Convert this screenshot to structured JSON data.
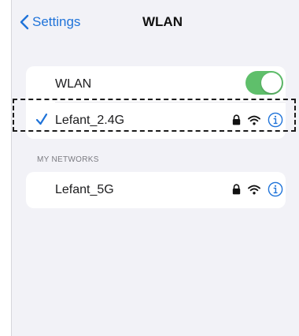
{
  "navbar": {
    "back_label": "Settings",
    "title": "WLAN"
  },
  "wlan_group": {
    "toggle_label": "WLAN",
    "toggle_on": true,
    "connected_network": "Lefant_2.4G"
  },
  "section_header": "MY NETWORKS",
  "my_networks": [
    {
      "name": "Lefant_5G"
    }
  ],
  "colors": {
    "accent": "#1f73d9",
    "toggle_on": "#5fbf6b",
    "background": "#f2f2f7"
  },
  "icons": [
    "chevron-left-icon",
    "checkmark-icon",
    "lock-icon",
    "wifi-icon",
    "info-icon"
  ]
}
